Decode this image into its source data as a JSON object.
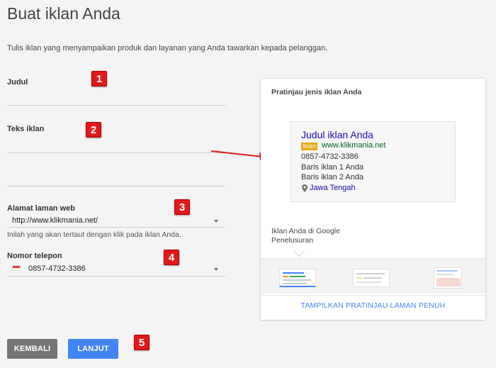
{
  "page": {
    "title": "Buat iklan Anda",
    "intro": "Tulis iklan yang menyampaikan produk dan layanan yang Anda tawarkan kepada pelanggan."
  },
  "form": {
    "headline_label": "Judul",
    "ad_text_label": "Teks iklan",
    "website_label": "Alamat laman web",
    "website_value": "http://www.klikmania.net/",
    "website_helper": "Inilah yang akan tertaut dengan klik pada iklan Anda.",
    "phone_label": "Nomor telepon",
    "phone_value": "0857-4732-3386"
  },
  "badges": [
    "1",
    "2",
    "3",
    "4",
    "5"
  ],
  "buttons": {
    "back": "KEMBALI",
    "next": "LANJUT"
  },
  "preview": {
    "title": "Pratinjau jenis iklan Anda",
    "ad_headline": "Judul iklan Anda",
    "ad_badge": "Iklan",
    "ad_url": "www.klikmania.net",
    "ad_phone": "0857-4732-3386",
    "ad_line1": "Baris iklan 1 Anda",
    "ad_line2": "Baris iklan 2 Anda",
    "ad_location": "Jawa Tengah",
    "placement": "Iklan Anda di Google Penelusuran",
    "full_preview_link": "TAMPILKAN PRATINJAU LAMAN PENUH"
  },
  "colors": {
    "primary_button": "#4285f4",
    "secondary_button": "#757575",
    "badge": "#e0191b",
    "ad_headline": "#1a0dab",
    "ad_url": "#006621",
    "ad_label": "#e5a50a"
  },
  "icons": {
    "location": "map-pin-icon",
    "flag": "indonesia-flag-icon",
    "dropdown": "caret-down-icon"
  }
}
